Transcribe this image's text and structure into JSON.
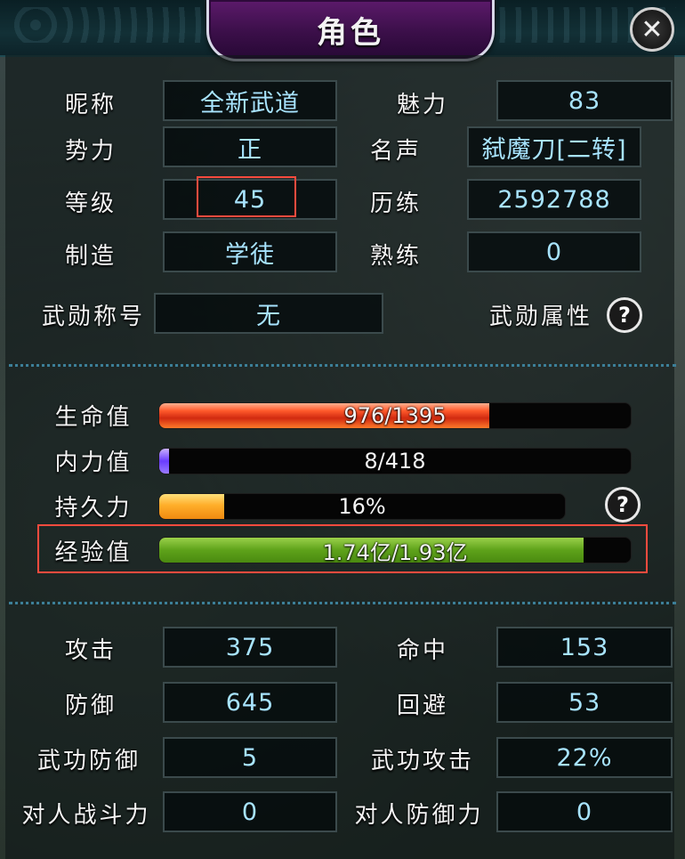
{
  "window": {
    "title": "角色",
    "close_icon": "close-icon"
  },
  "basic": {
    "nickname": {
      "label": "昵称",
      "value": "全新武道"
    },
    "charm": {
      "label": "魅力",
      "value": "83"
    },
    "faction": {
      "label": "势力",
      "value": "正"
    },
    "fame": {
      "label": "名声",
      "value": "弑魔刀[二转]"
    },
    "level": {
      "label": "等级",
      "value": "45"
    },
    "experience_pts": {
      "label": "历练",
      "value": "2592788"
    },
    "crafting": {
      "label": "制造",
      "value": "学徒"
    },
    "proficiency": {
      "label": "熟练",
      "value": "0"
    },
    "merit_title": {
      "label": "武勋称号",
      "value": "无"
    },
    "merit_attr": {
      "label": "武勋属性",
      "help_icon": "question-icon"
    }
  },
  "bars": {
    "hp": {
      "label": "生命值",
      "text": "976/1395",
      "fill": 0.7
    },
    "mp": {
      "label": "内力值",
      "text": "8/418",
      "fill": 0.02
    },
    "stamina": {
      "label": "持久力",
      "text": "16%",
      "fill": 0.16
    },
    "exp": {
      "label": "经验值",
      "text": "1.74亿/1.93亿",
      "fill": 0.9
    }
  },
  "combat": {
    "attack": {
      "label": "攻击",
      "value": "375"
    },
    "accuracy": {
      "label": "命中",
      "value": "153"
    },
    "defense": {
      "label": "防御",
      "value": "645"
    },
    "evasion": {
      "label": "回避",
      "value": "53"
    },
    "skill_defense": {
      "label": "武功防御",
      "value": "5"
    },
    "skill_attack": {
      "label": "武功攻击",
      "value": "22%"
    },
    "pvp_power": {
      "label": "对人战斗力",
      "value": "0"
    },
    "pvp_defense": {
      "label": "对人防御力",
      "value": "0"
    }
  },
  "colors": {
    "value_text": "#a8e4ff",
    "highlight": "#ff4b3e",
    "title_tab": "#3b0f49"
  }
}
